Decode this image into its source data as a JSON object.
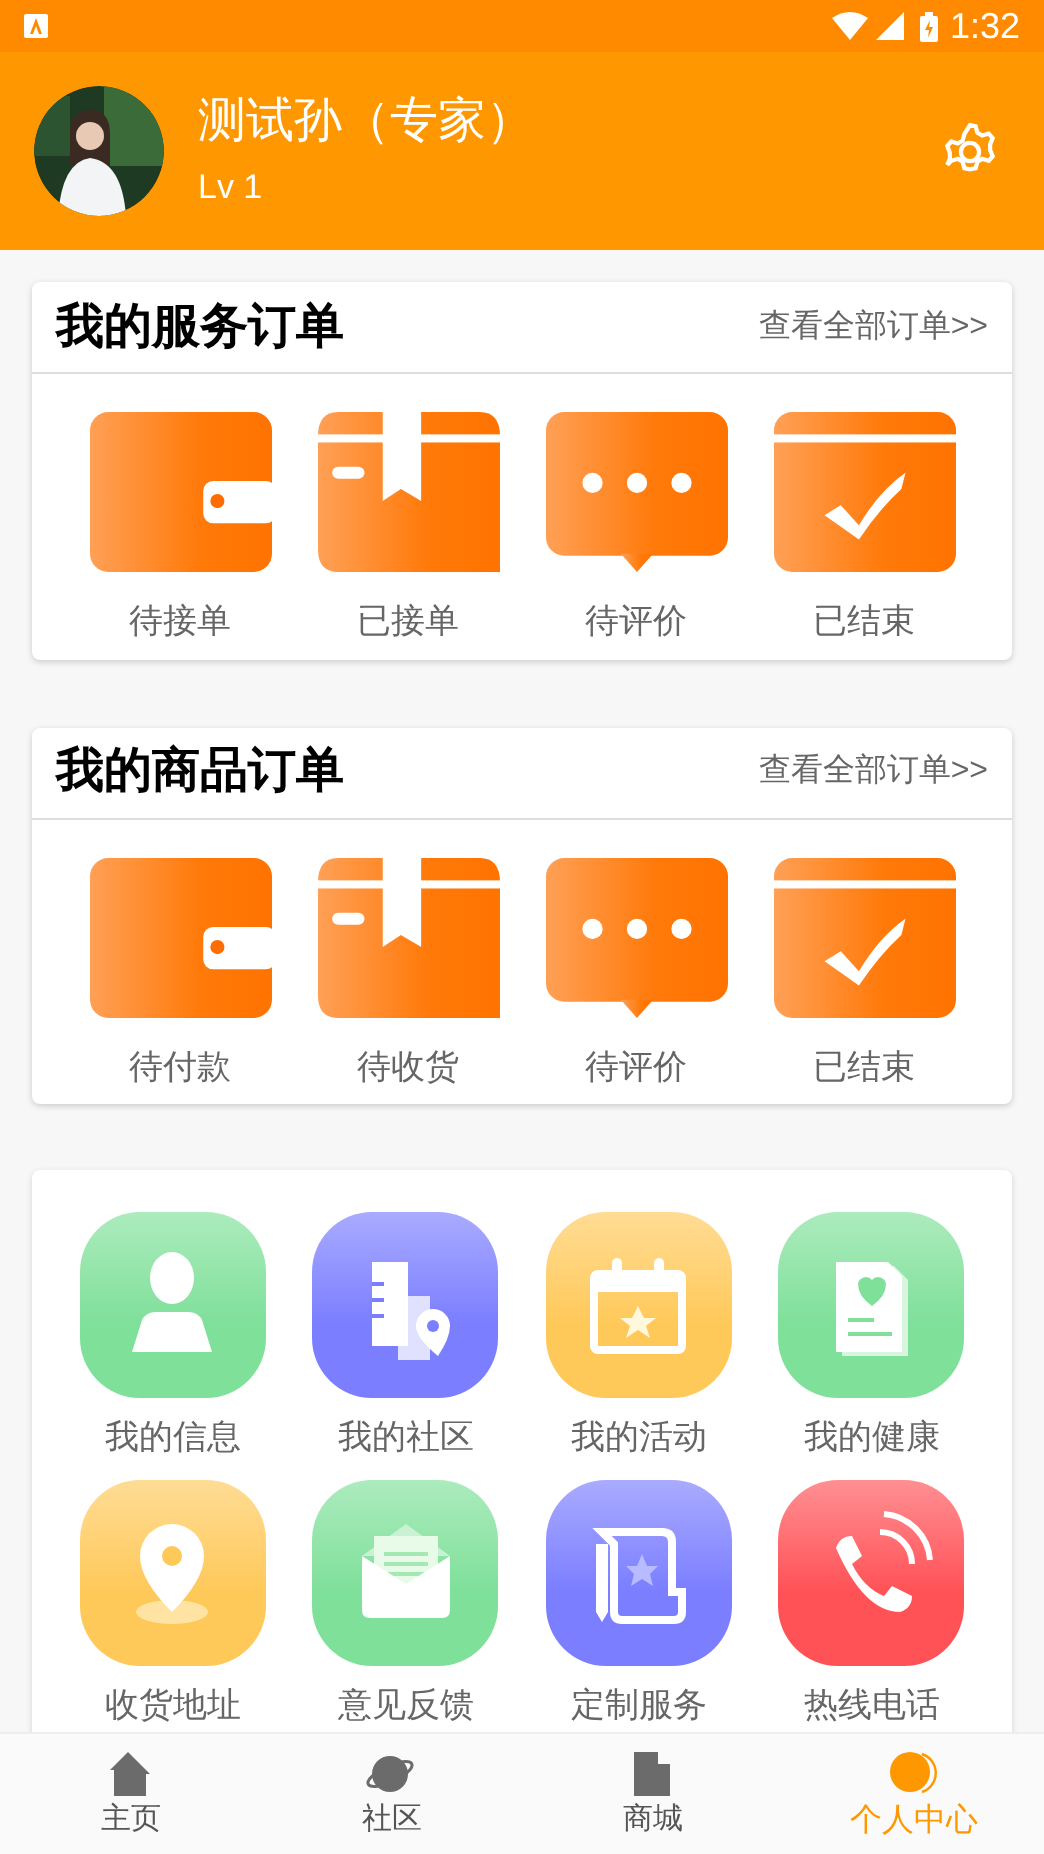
{
  "status_bar": {
    "time": "1:32"
  },
  "profile": {
    "name": "测试孙（专家）",
    "level": "Lv 1"
  },
  "order_sections": [
    {
      "title": "我的服务订单",
      "link": "查看全部订单>>",
      "items": [
        {
          "kind": "wallet",
          "label": "待接单"
        },
        {
          "kind": "box",
          "label": "已接单"
        },
        {
          "kind": "chat",
          "label": "待评价"
        },
        {
          "kind": "done",
          "label": "已结束"
        }
      ]
    },
    {
      "title": "我的商品订单",
      "link": "查看全部订单>>",
      "items": [
        {
          "kind": "wallet",
          "label": "待付款"
        },
        {
          "kind": "box",
          "label": "待收货"
        },
        {
          "kind": "chat",
          "label": "待评价"
        },
        {
          "kind": "done",
          "label": "已结束"
        }
      ]
    }
  ],
  "shortcuts": [
    {
      "kind": "person",
      "label": "我的信息",
      "color": "#7fe09a"
    },
    {
      "kind": "building",
      "label": "我的社区",
      "color": "#7b7eff"
    },
    {
      "kind": "calendar",
      "label": "我的活动",
      "color": "#ffc95a"
    },
    {
      "kind": "document",
      "label": "我的健康",
      "color": "#7fe09a"
    },
    {
      "kind": "pin",
      "label": "收货地址",
      "color": "#ffc95a"
    },
    {
      "kind": "mail",
      "label": "意见反馈",
      "color": "#7fe09a"
    },
    {
      "kind": "scroll",
      "label": "定制服务",
      "color": "#7b7eff"
    },
    {
      "kind": "phone",
      "label": "热线电话",
      "color": "#ff5257"
    }
  ],
  "nav": [
    {
      "kind": "home",
      "label": "主页",
      "selected": false
    },
    {
      "kind": "planet",
      "label": "社区",
      "selected": false
    },
    {
      "kind": "shop",
      "label": "商城",
      "selected": false
    },
    {
      "kind": "user",
      "label": "个人中心",
      "selected": true
    }
  ]
}
